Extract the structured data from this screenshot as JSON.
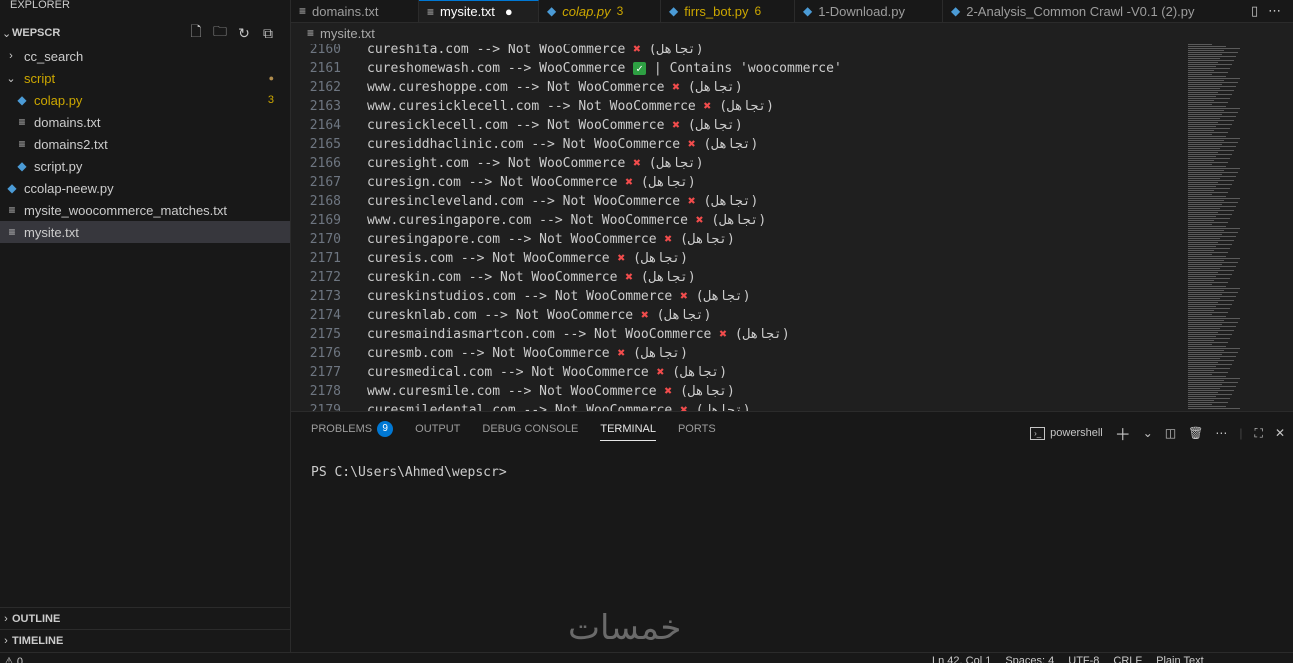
{
  "sidebar": {
    "title": "EXPLORER",
    "folder": "WEPSCR",
    "items": [
      {
        "label": "cc_search",
        "type": "folder",
        "expanded": false
      },
      {
        "label": "script",
        "type": "folder",
        "expanded": true
      },
      {
        "label": "colap.py",
        "type": "py",
        "badge": "3"
      },
      {
        "label": "domains.txt",
        "type": "txt"
      },
      {
        "label": "domains2.txt",
        "type": "txt"
      },
      {
        "label": "script.py",
        "type": "py"
      },
      {
        "label": "ccolap-neew.py",
        "type": "py"
      },
      {
        "label": "mysite_woocommerce_matches.txt",
        "type": "txt"
      },
      {
        "label": "mysite.txt",
        "type": "txt",
        "selected": true
      }
    ],
    "outline": "OUTLINE",
    "timeline": "TIMELINE"
  },
  "tabs": [
    {
      "label": "domains.txt"
    },
    {
      "label": "mysite.txt",
      "active": true
    },
    {
      "label": "colap.py",
      "count": "3"
    },
    {
      "label": "firrs_bot.py",
      "count": "6"
    },
    {
      "label": "1-Download.py"
    },
    {
      "label": "2-Analysis_Common Crawl -V0.1 (2).py"
    }
  ],
  "breadcrumb": "mysite.txt",
  "editor": {
    "lines": [
      {
        "n": "2160",
        "pre": "cureshita.com --> Not WooCommerce ",
        "mark": "x",
        "post": " (تجاهل)"
      },
      {
        "n": "2161",
        "pre": "cureshomewash.com --> WooCommerce ",
        "mark": "check",
        "post": " | Contains 'woocommerce'"
      },
      {
        "n": "2162",
        "pre": "www.cureshoppe.com --> Not WooCommerce ",
        "mark": "x",
        "post": " (تجاهل)"
      },
      {
        "n": "2163",
        "pre": "www.curesicklecell.com --> Not WooCommerce ",
        "mark": "x",
        "post": " (تجاهل)"
      },
      {
        "n": "2164",
        "pre": "curesicklecell.com --> Not WooCommerce ",
        "mark": "x",
        "post": " (تجاهل)"
      },
      {
        "n": "2165",
        "pre": "curesiddhaclinic.com --> Not WooCommerce ",
        "mark": "x",
        "post": " (تجاهل)"
      },
      {
        "n": "2166",
        "pre": "curesight.com --> Not WooCommerce ",
        "mark": "x",
        "post": " (تجاهل)"
      },
      {
        "n": "2167",
        "pre": "curesign.com --> Not WooCommerce ",
        "mark": "x",
        "post": " (تجاهل)"
      },
      {
        "n": "2168",
        "pre": "curesincleveland.com --> Not WooCommerce ",
        "mark": "x",
        "post": " (تجاهل)"
      },
      {
        "n": "2169",
        "pre": "www.curesingapore.com --> Not WooCommerce ",
        "mark": "x",
        "post": " (تجاهل)"
      },
      {
        "n": "2170",
        "pre": "curesingapore.com --> Not WooCommerce ",
        "mark": "x",
        "post": " (تجاهل)"
      },
      {
        "n": "2171",
        "pre": "curesis.com --> Not WooCommerce ",
        "mark": "x",
        "post": " (تجاهل)"
      },
      {
        "n": "2172",
        "pre": "cureskin.com --> Not WooCommerce ",
        "mark": "x",
        "post": " (تجاهل)"
      },
      {
        "n": "2173",
        "pre": "cureskinstudios.com --> Not WooCommerce ",
        "mark": "x",
        "post": " (تجاهل)"
      },
      {
        "n": "2174",
        "pre": "curesknlab.com --> Not WooCommerce ",
        "mark": "x",
        "post": " (تجاهل)"
      },
      {
        "n": "2175",
        "pre": "curesmaindiasmartcon.com --> Not WooCommerce ",
        "mark": "x",
        "post": " (تجاهل)"
      },
      {
        "n": "2176",
        "pre": "curesmb.com --> Not WooCommerce ",
        "mark": "x",
        "post": " (تجاهل)"
      },
      {
        "n": "2177",
        "pre": "curesmedical.com --> Not WooCommerce ",
        "mark": "x",
        "post": " (تجاهل)"
      },
      {
        "n": "2178",
        "pre": "www.curesmile.com --> Not WooCommerce ",
        "mark": "x",
        "post": " (تجاهل)"
      },
      {
        "n": "2179",
        "pre": "curesmiledental.com --> Not WooCommerce ",
        "mark": "x",
        "post": " (تجاهل)"
      }
    ]
  },
  "panel": {
    "tabs": [
      {
        "label": "PROBLEMS",
        "badge": "9"
      },
      {
        "label": "OUTPUT"
      },
      {
        "label": "DEBUG CONSOLE"
      },
      {
        "label": "TERMINAL",
        "active": true
      },
      {
        "label": "PORTS"
      }
    ],
    "shell": "powershell",
    "prompt": "PS C:\\Users\\Ahmed\\wepscr>"
  },
  "watermark": "خمسات",
  "status": {
    "problems": "0",
    "position": "Ln 42, Col 1",
    "spaces": "Spaces: 4",
    "encoding": "UTF-8",
    "eol": "CRLF",
    "language": "Plain Text"
  },
  "colors": {
    "accent": "#0078d4",
    "error_mark": "#f14c4c",
    "check": "#2ea043",
    "warning": "#cca700"
  }
}
